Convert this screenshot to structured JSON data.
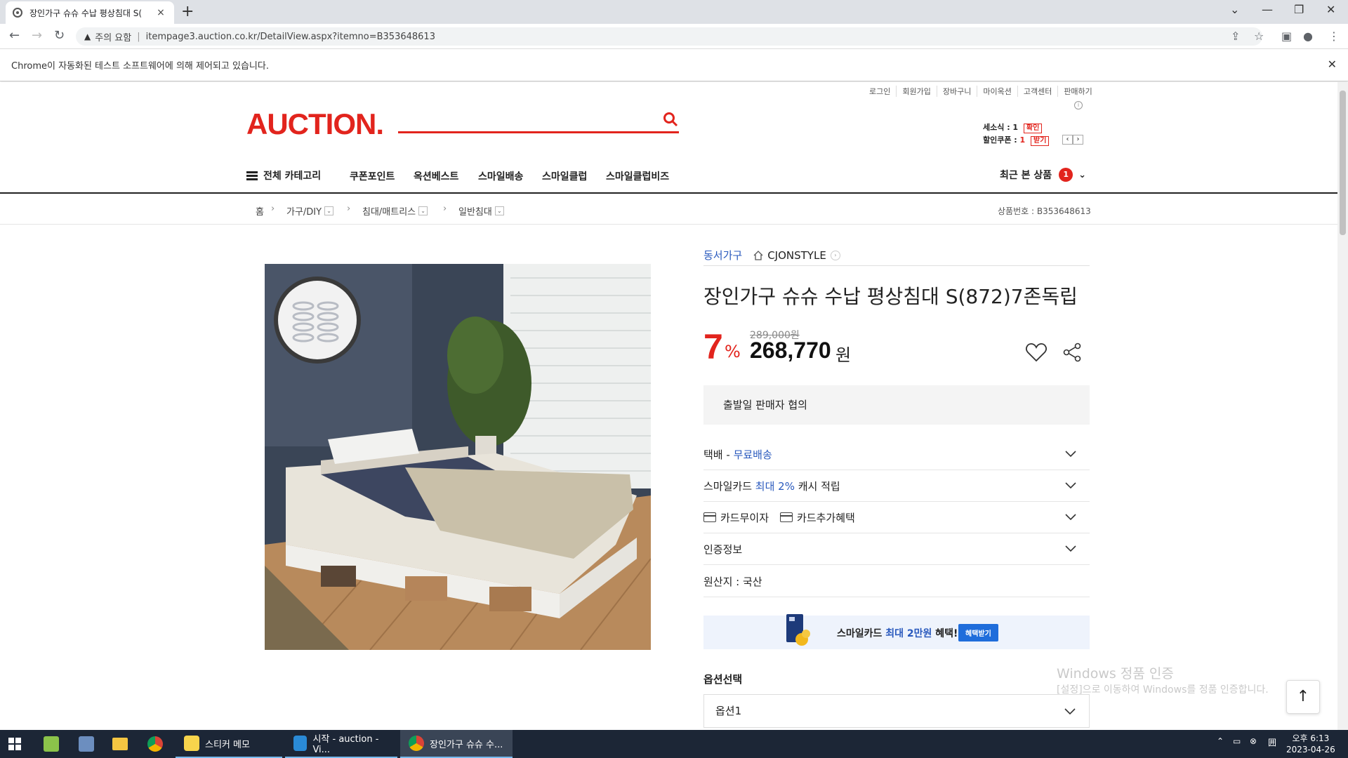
{
  "browser": {
    "tab_title": "장인가구 슈슈 수납 평상침대 S(",
    "tab_close": "×",
    "new_tab": "+",
    "security_label": "주의 요함",
    "url": "itempage3.auction.co.kr/DetailView.aspx?itemno=B353648613",
    "automation_notice": "Chrome이 자동화된 테스트 소프트웨어에 의해 제어되고 있습니다."
  },
  "header": {
    "util_links": [
      "로그인",
      "회원가입",
      "장바구니",
      "마이옥션",
      "고객센터",
      "판매하기"
    ],
    "logo": "AUCTION.",
    "coupon": {
      "smile_label": "세소식 : 1",
      "smile_badge": "확인",
      "discount_label": "할인쿠폰 : ",
      "discount_count": "1",
      "discount_badge": "받기"
    }
  },
  "gnb": {
    "all_category": "전체 카테고리",
    "menus": [
      "쿠폰포인트",
      "옥션베스트",
      "스마일배송",
      "스마일클럽",
      "스마일클럽비즈"
    ],
    "recent_label": "최근 본 상품",
    "recent_count": "1"
  },
  "breadcrumb": {
    "items": [
      "홈",
      "가구/DIY",
      "침대/매트리스",
      "일반침대"
    ],
    "product_no": "상품번호 : B353648613"
  },
  "product": {
    "brand": "동서가구",
    "store": "CJONSTYLE",
    "title": "장인가구 슈슈 수납 평상침대 S(872)7존독립",
    "discount": "7",
    "discount_unit": "%",
    "original_price": "289,000원",
    "price": "268,770",
    "price_unit": "원",
    "shipping_note": "출발일 판매자 협의",
    "delivery_prefix": "택배 - ",
    "delivery_value": "무료배송",
    "smilecard_prefix": "스마일카드 ",
    "smilecard_highlight": "최대 2%",
    "smilecard_suffix": " 캐시 적립",
    "card_interest": "카드무이자",
    "card_benefit": "카드추가혜택",
    "certification": "인증정보",
    "origin": "원산지 : 국산",
    "banner_prefix": "스마일카드 ",
    "banner_highlight": "최대 2만원",
    "banner_suffix": " 혜택!",
    "banner_button": "혜택받기",
    "option_title": "옵션선택",
    "option_value": "옵션1"
  },
  "overlay": {
    "watermark_title": "Windows 정품 인증",
    "watermark_sub": "[설정]으로 이동하여 Windows를 정품 인증합니다."
  },
  "taskbar": {
    "apps": [
      "스티커 메모",
      "시작 - auction - Vi...",
      "장인가구 슈슈 수..."
    ],
    "time": "오후 6:13",
    "date": "2023-04-26"
  },
  "colors": {
    "brand_red": "#e2241d",
    "link_blue": "#2959bd",
    "taskbar": "#1c2636"
  }
}
